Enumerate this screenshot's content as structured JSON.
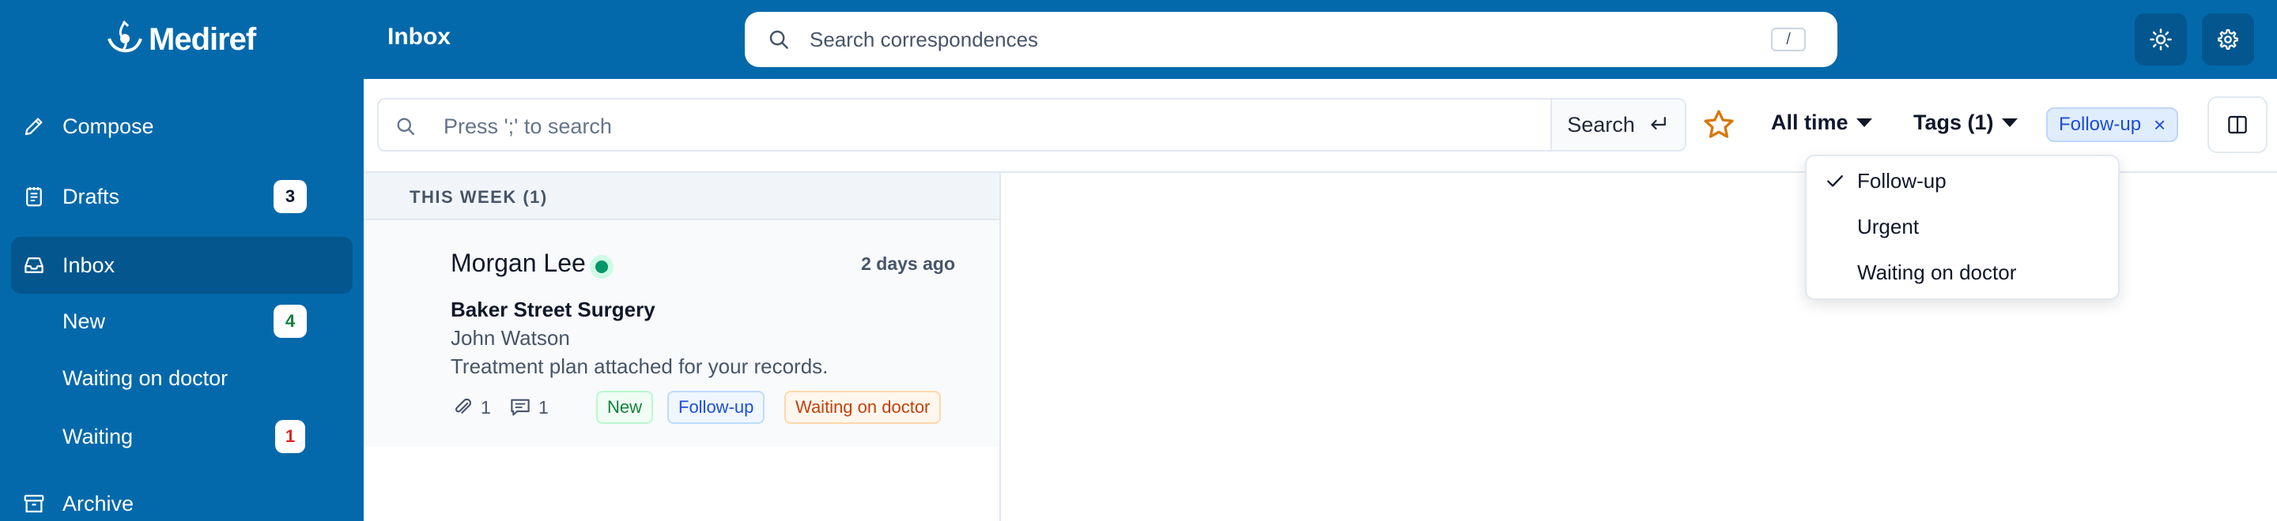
{
  "app": {
    "name": "Mediref",
    "section_title": "Inbox"
  },
  "header": {
    "search_placeholder": "Search correspondences",
    "search_shortcut": "/",
    "theme_icon": "sun-icon",
    "settings_icon": "gear-icon"
  },
  "sidebar": {
    "items": [
      {
        "label": "Compose",
        "icon": "pencil-icon"
      },
      {
        "label": "Drafts",
        "icon": "draft-icon",
        "badge": "3"
      },
      {
        "label": "Inbox",
        "icon": "inbox-icon",
        "active": true
      },
      {
        "label": "New",
        "badge": "4",
        "badge_color": "#15803d"
      },
      {
        "label": "Waiting on doctor"
      },
      {
        "label": "Waiting",
        "badge": "1",
        "badge_color": "#dc2626"
      },
      {
        "label": "Archive",
        "icon": "archive-icon"
      }
    ]
  },
  "toolbar": {
    "search_placeholder": "Press ';' to search",
    "search_button": "Search",
    "time_filter": "All time",
    "tags_filter": "Tags (1)",
    "active_tag": "Follow-up",
    "remove_tag": "×"
  },
  "list": {
    "group_label": "THIS WEEK (1)",
    "messages": [
      {
        "sender": "Morgan Lee",
        "time": "2 days ago",
        "subject": "Baker Street Surgery",
        "from": "John Watson",
        "snippet": "Treatment plan attached for your records.",
        "attachments": "1",
        "comments": "1",
        "tags": [
          {
            "label": "New",
            "color": "#15803d",
            "bg": "#f0fdf4",
            "border": "#bbf7d0"
          },
          {
            "label": "Follow-up",
            "color": "#1d4ed8",
            "bg": "#eff6ff",
            "border": "#bfdbfe"
          },
          {
            "label": "Waiting on doctor",
            "color": "#c2410c",
            "bg": "#fff7ed",
            "border": "#fed7aa"
          }
        ]
      }
    ]
  },
  "tags_dropdown": {
    "options": [
      {
        "label": "Follow-up",
        "checked": true
      },
      {
        "label": "Urgent",
        "checked": false
      },
      {
        "label": "Waiting on doctor",
        "checked": false
      }
    ]
  },
  "colors": {
    "brand": "#0469ab",
    "brand_dark": "#03578e",
    "star": "#d97706"
  }
}
